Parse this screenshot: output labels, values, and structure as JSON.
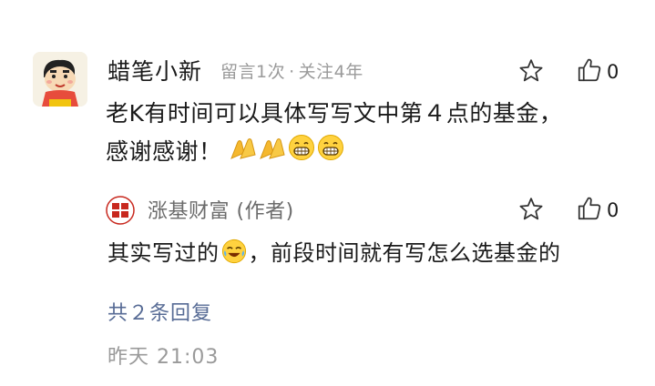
{
  "comment": {
    "username": "蜡笔小新",
    "meta_left": "留言1次",
    "meta_sep": "·",
    "meta_right": "关注4年",
    "likes": "0",
    "text_line1": "老K有时间可以具体写写文中第４点的基金，",
    "text_line2": "感谢感谢！",
    "emojis": [
      "clap-icon",
      "clap-icon",
      "grin-icon",
      "grin-icon"
    ]
  },
  "reply": {
    "author": "涨基财富 (作者)",
    "likes": "0",
    "text_before": "其实写过的",
    "emoji": "laugh-cry-icon",
    "text_after": "，前段时间就有写怎么选基金的"
  },
  "more_replies": "共２条回复",
  "timestamp": "昨天 21:03",
  "colors": {
    "link": "#576b95",
    "meta": "#9a9a9a",
    "text": "#1a1a1a",
    "seal": "#c8281e"
  }
}
